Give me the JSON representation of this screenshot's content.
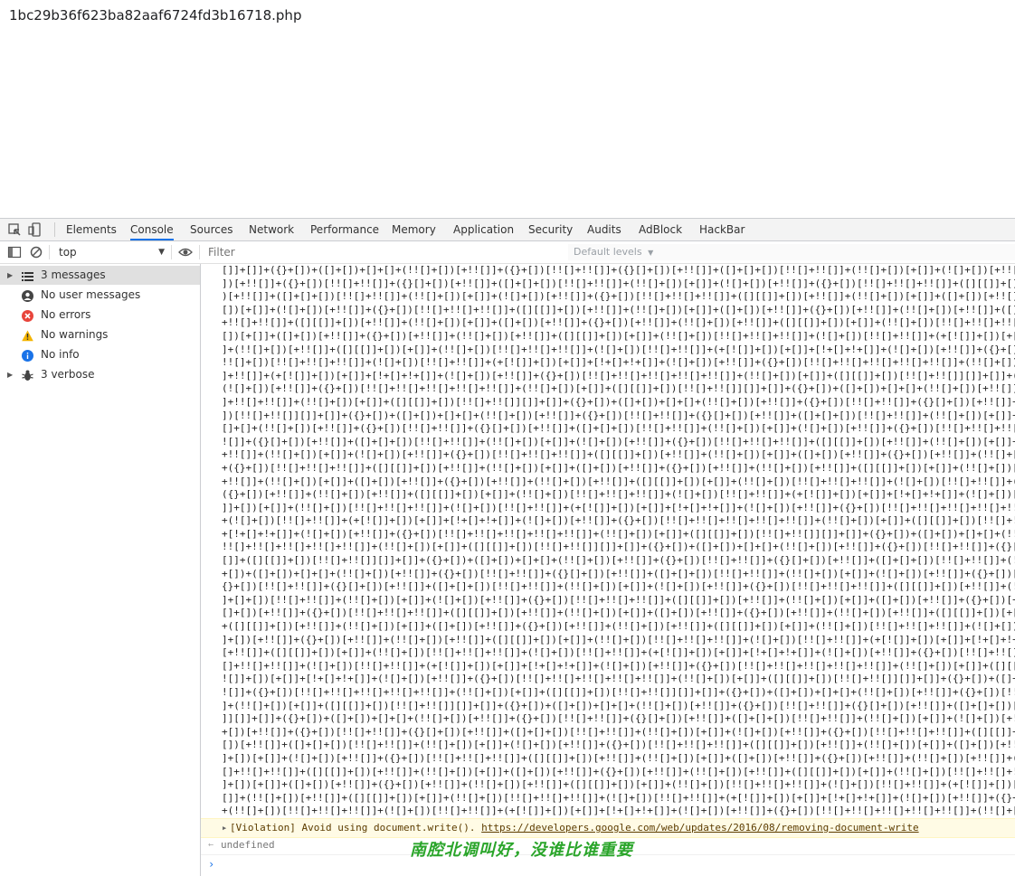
{
  "page": {
    "title": "1bc29b36f623ba82aaf6724fd3b16718.php"
  },
  "devtools": {
    "tabs": [
      "Elements",
      "Console",
      "Sources",
      "Network",
      "Performance",
      "Memory",
      "Application",
      "Security",
      "Audits",
      "AdBlock",
      "HackBar"
    ],
    "active_tab": "Console"
  },
  "toolbar": {
    "context": "top",
    "filter_placeholder": "Filter",
    "levels_label": "Default levels"
  },
  "sidebar": {
    "items": [
      {
        "label": "3 messages",
        "icon": "list-icon"
      },
      {
        "label": "No user messages",
        "icon": "user-icon"
      },
      {
        "label": "No errors",
        "icon": "error-icon"
      },
      {
        "label": "No warnings",
        "icon": "warning-icon"
      },
      {
        "label": "No info",
        "icon": "info-icon"
      },
      {
        "label": "3 verbose",
        "icon": "bug-icon"
      }
    ]
  },
  "console": {
    "jsfuck_line": "[]]+[]]+({}+[])+([]+[])+[]+[]+(!![]+[])[+!![]]+({}+[])[!![]+!![]]+({}[]+[])[+!![]]+([]+[]+[])[!![]+!![]]+(!![]+[])[+[]]+(![]+[])[+!![]]+({}+[])[!![]+!![]+!![]]+([][[]]+[])[+!![]]+(!![]+[])[+[]]+([]+[])[+!![]]+({}+[])[+!![]]+(!![]+[])[+!![]]+([][[]]+[])[+[]]+(!![]+[])[!![]+!![]+!![]]+(![]+[])[!![]+!![]]+(+[![]]+[])[+[]]+[!+[]+!+[]]+(![]+[])[+!![]]+({}+[])[!![]+!![]+!![]+!![]+!![]]+(!![]+[])[+[]]+([][[]]+[])[!![]+!![]]",
    "violation": {
      "text": "[Violation] Avoid using document.write(). ",
      "link": "https://developers.google.com/web/updates/2016/08/removing-document-write"
    },
    "result": "undefined",
    "overlay_text": "南腔北调叫好，没谁比谁重要"
  }
}
